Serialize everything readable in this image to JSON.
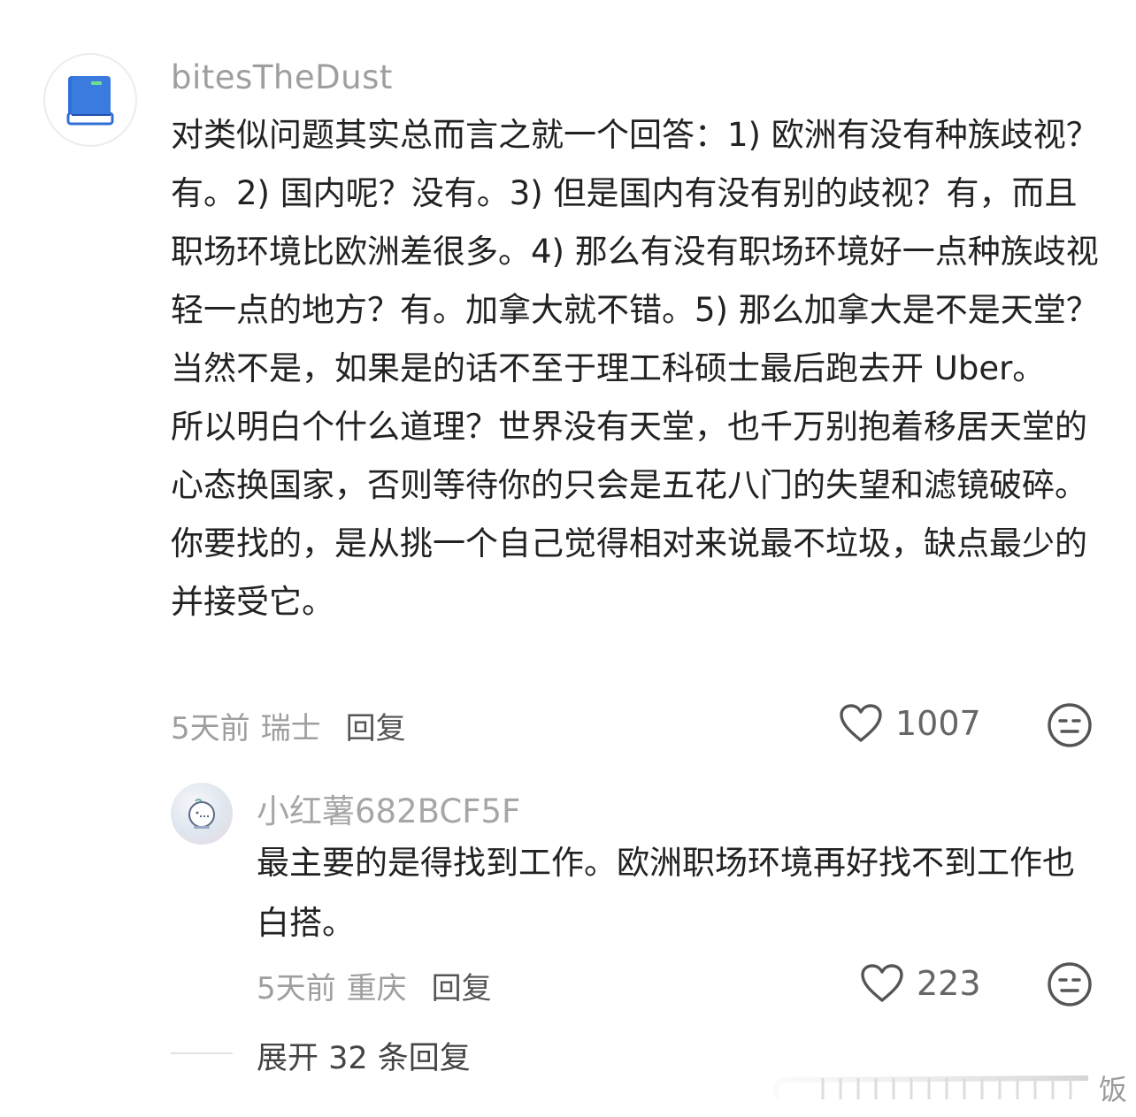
{
  "comment": {
    "username": "bitesTheDust",
    "avatar_icon": "blue-book-icon",
    "paragraphs": [
      "对类似问题其实总而言之就一个回答：1) 欧洲有没有种族歧视？有。2) 国内呢？没有。3) 但是国内有没有别的歧视？有，而且职场环境比欧洲差很多。4) 那么有没有职场环境好一点种族歧视轻一点的地方？有。加拿大就不错。5) 那么加拿大是不是天堂？当然不是，如果是的话不至于理工科硕士最后跑去开 Uber。",
      "所以明白个什么道理？世界没有天堂，也千万别抱着移居天堂的心态换国家，否则等待你的只会是五花八门的失望和滤镜破碎。你要找的，是从挑一个自己觉得相对来说最不垃圾，缺点最少的并接受它。"
    ],
    "time": "5天前",
    "location": "瑞士",
    "reply_label": "回复",
    "like_count": "1007"
  },
  "reply": {
    "username": "小红薯682BCF5F",
    "text": "最主要的是得找到工作。欧洲职场环境再好找不到工作也白搭。",
    "time": "5天前",
    "location": "重庆",
    "reply_label": "回复",
    "like_count": "223"
  },
  "expand_replies": "展开 32 条回复",
  "watermark": "饭"
}
